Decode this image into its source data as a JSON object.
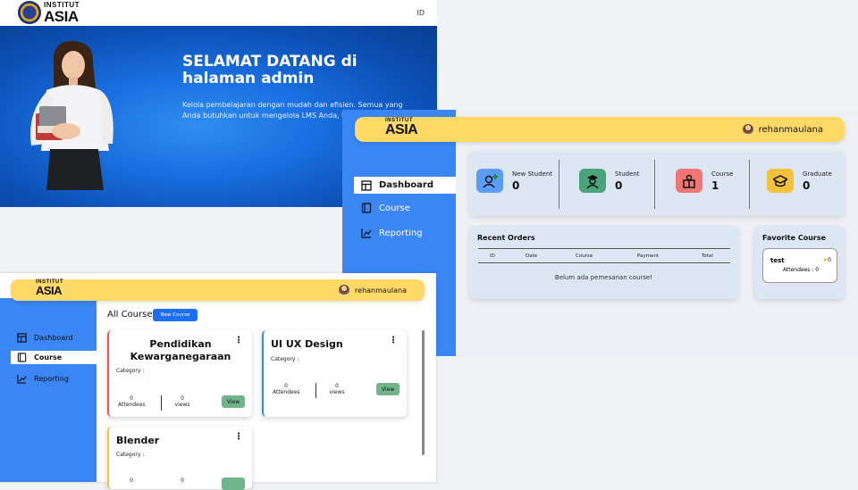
{
  "welcome": {
    "logo": {
      "small": "INSTITUT",
      "large": "ASIA",
      "seal": "ASIA"
    },
    "lang": "ID",
    "title_line1": "SELAMAT DATANG di",
    "title_line2": "halaman admin",
    "desc_line1": "Kelola pembelajaran dengan mudah dan efisien. Semua yang",
    "desc_line2": "Anda butuhkan untuk mengelola LMS Anda, ters"
  },
  "dashboard": {
    "logo": {
      "small": "INSTITUT",
      "large": "ASIA"
    },
    "username": "rehanmaulana",
    "nav": [
      {
        "label": "Dashboard",
        "icon": "dashboard-icon"
      },
      {
        "label": "Course",
        "icon": "book-icon"
      },
      {
        "label": "Reporting",
        "icon": "chart-icon"
      }
    ],
    "stats": [
      {
        "label": "New Student",
        "value": "0",
        "color": "#5b9cf4"
      },
      {
        "label": "Student",
        "value": "0",
        "color": "#4aa37a"
      },
      {
        "label": "Course",
        "value": "1",
        "color": "#f07575"
      },
      {
        "label": "Graduate",
        "value": "0",
        "color": "#f5c23c"
      }
    ],
    "orders": {
      "title": "Recent Orders",
      "columns": [
        "ID",
        "Date",
        "Course",
        "Payment",
        "Total"
      ],
      "empty": "Belum ada pemesanan course!"
    },
    "favorite": {
      "title": "Favorite Course",
      "course": "test",
      "rating": "0",
      "attendees": "Attendees : 0"
    }
  },
  "courses": {
    "logo": {
      "small": "INSTITUT",
      "large": "ASIA"
    },
    "username": "rehanmaulana",
    "nav": [
      {
        "label": "Dashboard",
        "icon": "dashboard-icon"
      },
      {
        "label": "Course",
        "icon": "book-icon"
      },
      {
        "label": "Reporting",
        "icon": "chart-icon"
      }
    ],
    "title": "All Course",
    "new_button": "New Course",
    "items": [
      {
        "name_line1": "Pendidikan",
        "name_line2": "Kewarganegaraan",
        "category": "Category :",
        "attendees": "0",
        "attendees_label": "Attendees",
        "views": "0",
        "views_label": "views",
        "view_btn": "View",
        "accent": "#e05555"
      },
      {
        "name_line1": "UI UX Design",
        "name_line2": "",
        "category": "Category :",
        "attendees": "0",
        "attendees_label": "Attendees",
        "views": "0",
        "views_label": "views",
        "view_btn": "View",
        "accent": "#3a86f5"
      },
      {
        "name_line1": "Blender",
        "name_line2": "",
        "category": "Category :",
        "attendees": "0",
        "attendees_label": "",
        "views": "0",
        "views_label": "",
        "view_btn": "",
        "accent": "#f5c23c"
      }
    ]
  }
}
